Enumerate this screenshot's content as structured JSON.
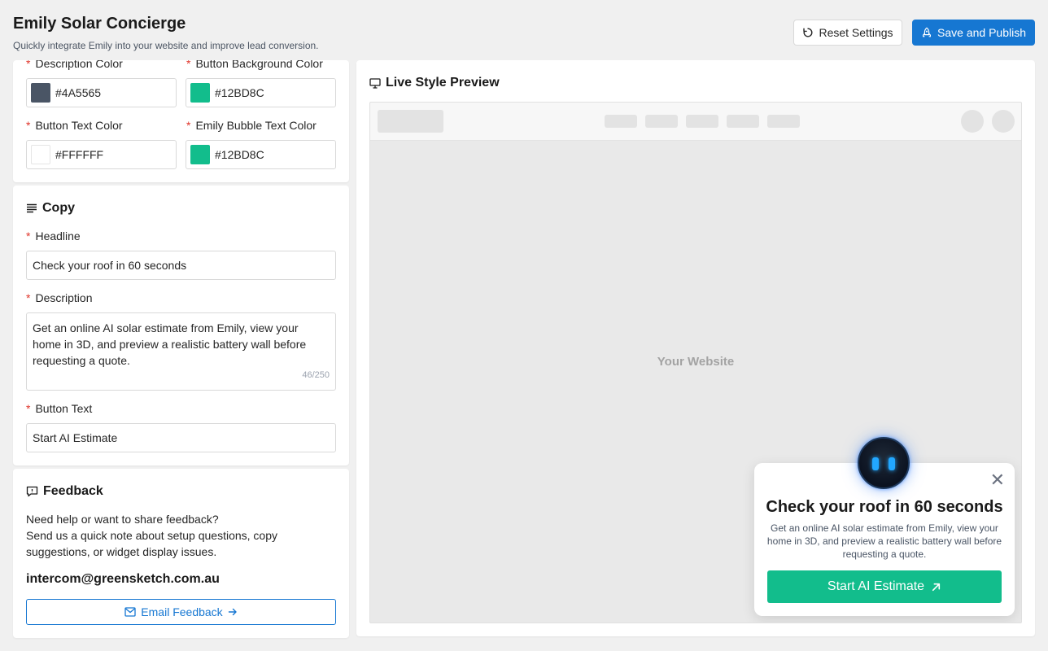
{
  "header": {
    "title": "Emily Solar Concierge",
    "subtitle": "Quickly integrate Emily into your website and improve lead conversion.",
    "reset_label": "Reset Settings",
    "save_label": "Save and Publish"
  },
  "colors": {
    "description_color": {
      "label": "Description Color",
      "value": "#4A5565",
      "swatch": "#4A5565"
    },
    "button_bg_color": {
      "label": "Button Background Color",
      "value": "#12BD8C",
      "swatch": "#12BD8C"
    },
    "button_text_color": {
      "label": "Button Text Color",
      "value": "#FFFFFF",
      "swatch": "#FFFFFF"
    },
    "bubble_text_color": {
      "label": "Emily Bubble Text Color",
      "value": "#12BD8C",
      "swatch": "#12BD8C"
    }
  },
  "copy": {
    "title": "Copy",
    "headline_label": "Headline",
    "headline_value": "Check your roof in 60 seconds",
    "description_label": "Description",
    "description_value": "Get an online AI solar estimate from Emily, view your home in 3D, and preview a realistic battery wall before requesting a quote.",
    "description_counter": "46/250",
    "button_label": "Button Text",
    "button_value": "Start AI Estimate"
  },
  "feedback": {
    "title": "Feedback",
    "line1": "Need help or want to share feedback?",
    "line2": "Send us a quick note about setup questions, copy suggestions, or widget display issues.",
    "email": "intercom@greensketch.com.au",
    "button_label": "Email Feedback"
  },
  "preview": {
    "title": "Live Style Preview",
    "site_label": "Your Website",
    "widget": {
      "headline": "Check your roof in 60 seconds",
      "description": "Get an online AI solar estimate from Emily, view your home in 3D, and preview a realistic battery wall before requesting a quote.",
      "button": "Start AI Estimate"
    }
  },
  "theme": {
    "primary": "#1677D2",
    "accent": "#12BD8C",
    "required": "#E0352B"
  }
}
